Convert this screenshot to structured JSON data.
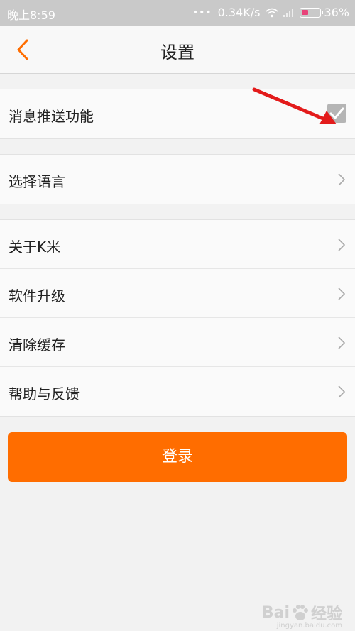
{
  "status_bar": {
    "time": "晚上8:59",
    "dots": "•••",
    "speed": "0.34K/s",
    "battery": "36%"
  },
  "nav": {
    "title": "设置"
  },
  "settings": {
    "push": {
      "label": "消息推送功能",
      "checked": true
    },
    "language": {
      "label": "选择语言"
    },
    "about": {
      "label": "关于K米"
    },
    "upgrade": {
      "label": "软件升级"
    },
    "cache": {
      "label": "清除缓存"
    },
    "help": {
      "label": "帮助与反馈"
    }
  },
  "login_label": "登录",
  "watermark": {
    "brand_left": "Bai",
    "brand_right": "经验",
    "url": "jingyan.baidu.com"
  },
  "colors": {
    "accent": "#ff6d00",
    "status_bar": "#c9c9c9",
    "annotation_arrow": "#e31b1b"
  }
}
